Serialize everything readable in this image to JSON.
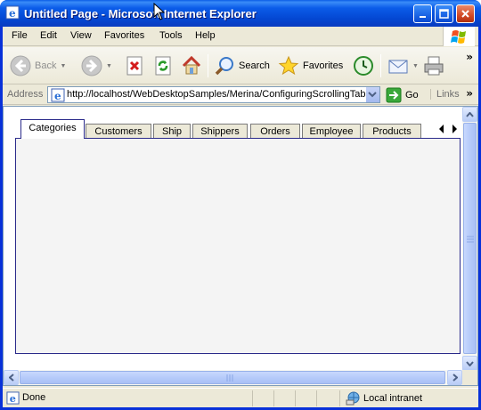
{
  "window": {
    "title": "Untitled Page - Microsoft Internet Explorer"
  },
  "menu": {
    "items": [
      "File",
      "Edit",
      "View",
      "Favorites",
      "Tools",
      "Help"
    ]
  },
  "toolbar": {
    "back_label": "Back",
    "search_label": "Search",
    "favorites_label": "Favorites"
  },
  "address": {
    "label": "Address",
    "url": "http://localhost/WebDesktopSamples/Merina/ConfiguringScrollingTabBar.aspx",
    "go_label": "Go",
    "links_label": "Links"
  },
  "tabs": {
    "items": [
      "Categories",
      "Customers",
      "Ship",
      "Shippers",
      "Orders",
      "Employee",
      "Products"
    ],
    "active_index": 0
  },
  "status": {
    "text": "Done",
    "zone": "Local intranet"
  },
  "colors": {
    "title_bar": "#0a52d8",
    "frame": "#ece9d8",
    "tab_border": "#2a2a8a",
    "panel_bg": "#f4f4f4"
  }
}
